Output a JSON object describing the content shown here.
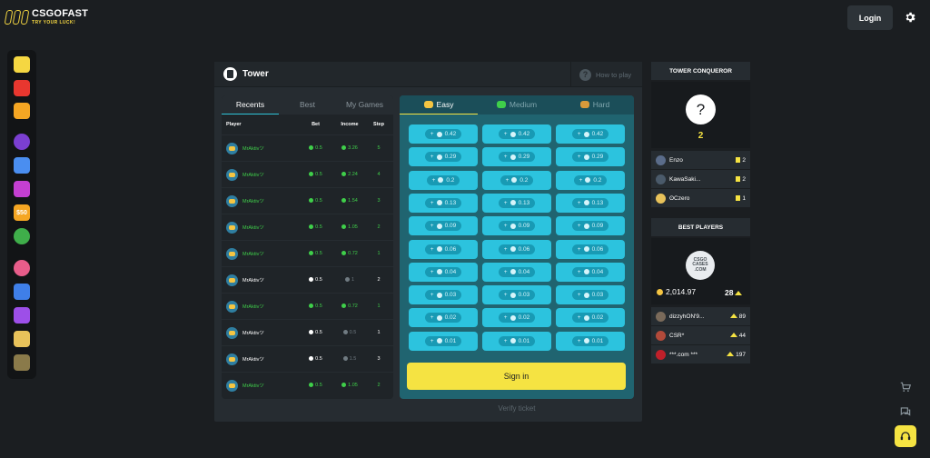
{
  "header": {
    "logo_name": "CSGOFAST",
    "logo_tagline": "TRY YOUR LUCK!",
    "login_label": "Login",
    "accent": "#f5e342"
  },
  "rail": {
    "icons": [
      "crown-icon",
      "fire-icon",
      "crossed-swords-icon",
      "roulette-icon",
      "rocket-icon",
      "dice-icon",
      "cases-icon",
      "pie-icon",
      "diamond-icon",
      "trophy-icon",
      "tower-icon",
      "coin-stack-icon",
      "star-icon"
    ],
    "cases_badge": "$50"
  },
  "tower": {
    "title": "Tower",
    "how_to_play": "How to play",
    "list_tabs": [
      "Recents",
      "Best",
      "My Games"
    ],
    "columns": [
      "Player",
      "Bet",
      "Income",
      "Step"
    ],
    "rows": [
      {
        "player": "MrAktivツ",
        "bet": "0.5",
        "income": "3.26",
        "step": "5",
        "result": "win"
      },
      {
        "player": "MrAktivツ",
        "bet": "0.5",
        "income": "2.24",
        "step": "4",
        "result": "win"
      },
      {
        "player": "MrAktivツ",
        "bet": "0.5",
        "income": "1.54",
        "step": "3",
        "result": "win"
      },
      {
        "player": "MrAktivツ",
        "bet": "0.5",
        "income": "1.05",
        "step": "2",
        "result": "win"
      },
      {
        "player": "MrAktivツ",
        "bet": "0.5",
        "income": "0.72",
        "step": "1",
        "result": "win"
      },
      {
        "player": "MrAktivツ",
        "bet": "0.5",
        "income": "1",
        "step": "2",
        "result": "lose"
      },
      {
        "player": "MrAktivツ",
        "bet": "0.5",
        "income": "0.72",
        "step": "1",
        "result": "win"
      },
      {
        "player": "MrAktivツ",
        "bet": "0.5",
        "income": "0.5",
        "step": "1",
        "result": "lose"
      },
      {
        "player": "MrAktivツ",
        "bet": "0.5",
        "income": "1.5",
        "step": "3",
        "result": "lose"
      },
      {
        "player": "MrAktivツ",
        "bet": "0.5",
        "income": "1.05",
        "step": "2",
        "result": "win"
      }
    ],
    "difficulty_tabs": [
      {
        "label": "Easy",
        "icon": "easy-icon",
        "active": true
      },
      {
        "label": "Medium",
        "icon": "medium-icon",
        "active": false
      },
      {
        "label": "Hard",
        "icon": "hard-icon",
        "active": false
      }
    ],
    "multipliers": [
      "0.42",
      "0.29",
      "0.2",
      "0.13",
      "0.09",
      "0.06",
      "0.04",
      "0.03",
      "0.02",
      "0.01"
    ],
    "cell_prefix": "+",
    "signin_label": "Sign in",
    "verify_label": "Verify ticket"
  },
  "conqueror": {
    "title": "TOWER CONQUEROR",
    "count": "2",
    "players": [
      {
        "name": "Enzo",
        "value": "2"
      },
      {
        "name": "KawaSaki...",
        "value": "2"
      },
      {
        "name": "ʘCzero",
        "value": "1"
      }
    ]
  },
  "best": {
    "title": "BEST PLAYERS",
    "logo_lines": [
      "CSGO",
      "CASES",
      ".COM"
    ],
    "balance": "2,014.97",
    "level": "28",
    "players": [
      {
        "name": "dizzyhON'9...",
        "value": "89"
      },
      {
        "name": "CSR*",
        "value": "44"
      },
      {
        "name": "***.com ***",
        "value": "197"
      }
    ]
  }
}
